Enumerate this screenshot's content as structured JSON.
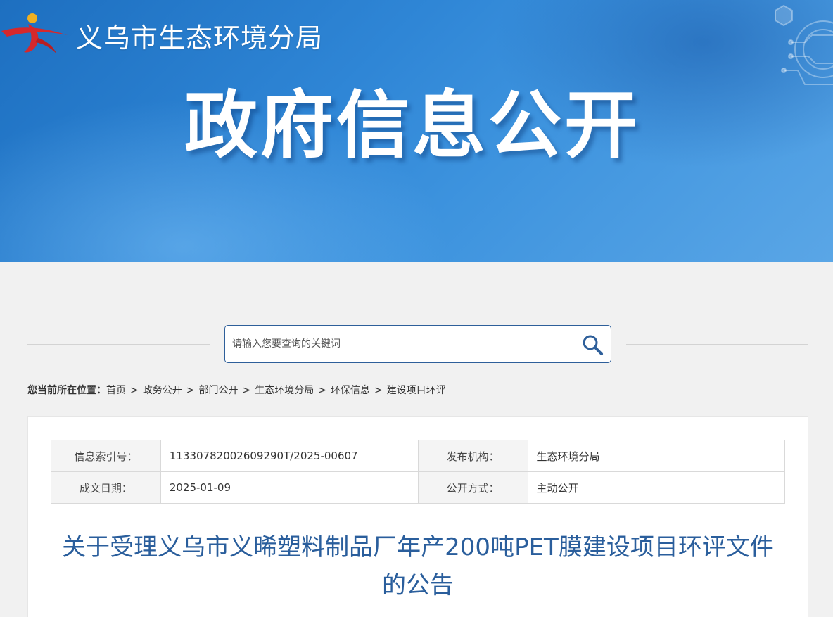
{
  "header": {
    "site_name": "义乌市生态环境分局",
    "hero_title": "政府信息公开"
  },
  "search": {
    "placeholder": "请输入您要查询的关键词"
  },
  "breadcrumb": {
    "lead": "您当前所在位置：",
    "items": [
      "首页",
      "政务公开",
      "部门公开",
      "生态环境分局",
      "环保信息",
      "建设项目环评"
    ],
    "separator": ">"
  },
  "meta": {
    "rows": [
      {
        "k1": "信息索引号：",
        "v1": "11330782002609290T/2025-00607",
        "k2": "发布机构：",
        "v2": "生态环境分局"
      },
      {
        "k1": "成文日期：",
        "v1": "2025-01-09",
        "k2": "公开方式：",
        "v2": "主动公开"
      }
    ]
  },
  "document": {
    "title_line1": "关于受理义乌市义晞塑料制品厂年产200吨PET膜建设项目环评文件",
    "title_line2": "的公告"
  },
  "colors": {
    "banner_blue": "#2f86d6",
    "title_blue": "#2a5e9c",
    "search_border": "#2e5f9a",
    "logo_red": "#d6282c"
  }
}
